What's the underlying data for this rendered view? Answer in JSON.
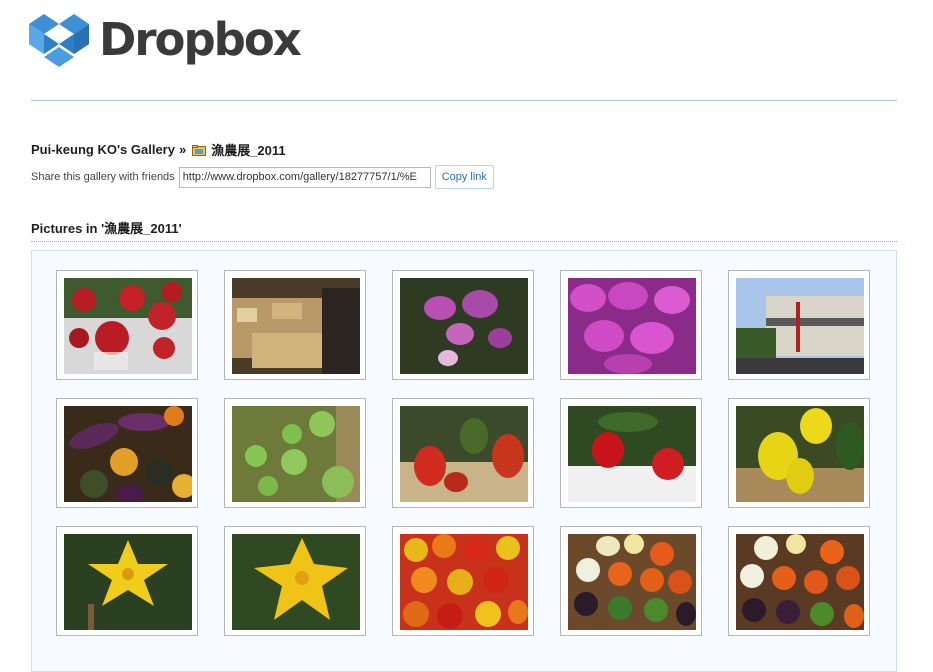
{
  "brand": {
    "name": "Dropbox"
  },
  "breadcrumb": {
    "gallery_owner": "Pui-keung KO's Gallery",
    "separator": "»",
    "album": "漁農展_2011"
  },
  "share": {
    "label": "Share this gallery with friends",
    "url": "http://www.dropbox.com/gallery/18277757/1/%E",
    "copy_label": "Copy link"
  },
  "pictures_heading": "Pictures in '漁農展_2011'",
  "photos": [
    {
      "subject": "red apples in foam nets"
    },
    {
      "subject": "market stall with dried goods"
    },
    {
      "subject": "purple orchids"
    },
    {
      "subject": "magenta orchid cluster"
    },
    {
      "subject": "exhibition hall exterior"
    },
    {
      "subject": "purple eggplants and gourds"
    },
    {
      "subject": "green tomatoes on vine"
    },
    {
      "subject": "red and green peppers on straw"
    },
    {
      "subject": "strawberries on plant"
    },
    {
      "subject": "yellow bell peppers"
    },
    {
      "subject": "yellow squash blossom"
    },
    {
      "subject": "yellow squash flower"
    },
    {
      "subject": "colorful bell pepper pile"
    },
    {
      "subject": "bell pepper display"
    },
    {
      "subject": "bell pepper rows"
    }
  ],
  "colors": {
    "link": "#2a6fb5",
    "divider": "#a9c8e0",
    "gallery_bg": "#f7fbff"
  }
}
